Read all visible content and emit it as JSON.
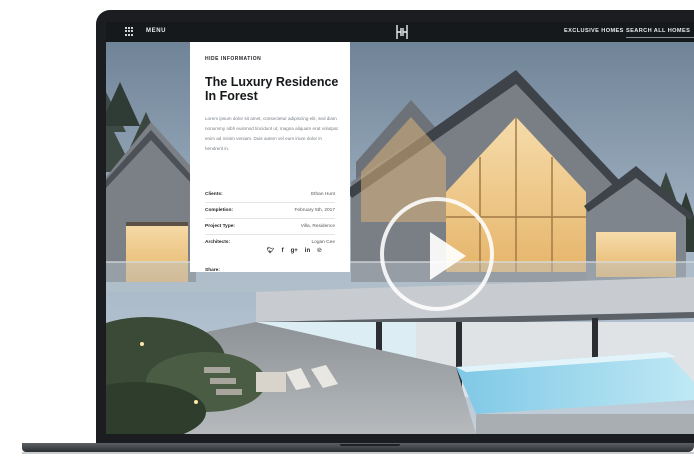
{
  "topbar": {
    "menu_label": "MENU",
    "nav_items": [
      "EXCLUSIVE HOMES",
      "SEARCH ALL HOMES"
    ],
    "active_nav": "SEARCH ALL HOMES"
  },
  "card": {
    "hide_label": "HIDE INFORMATION",
    "title_line1": "The Luxury Residence",
    "title_line2": "In Forest",
    "description": "Lorem ipsum dolor sit amet, consectetur adipiscing elit, sed diam nonummy nibh euismod tincidunt ut, magna aliquam erat volutpat enim ad minim veniam. Duis autem vel eum iriure dolor in hendrerit in.",
    "details": [
      {
        "label": "Clients:",
        "value": "Ethan Hunt"
      },
      {
        "label": "Completion:",
        "value": "February 5th, 2017"
      },
      {
        "label": "Project Type:",
        "value": "Villa, Residence"
      },
      {
        "label": "Architects:",
        "value": "Logan Cee"
      }
    ],
    "share_label": "Share:",
    "share_icons": [
      "twitter-icon",
      "facebook-icon",
      "google-plus-icon",
      "linkedin-icon",
      "pinterest-icon"
    ]
  },
  "colors": {
    "topbar": "#16191c",
    "card_bg": "#ffffff",
    "laptop_frame": "#1b1d20"
  }
}
